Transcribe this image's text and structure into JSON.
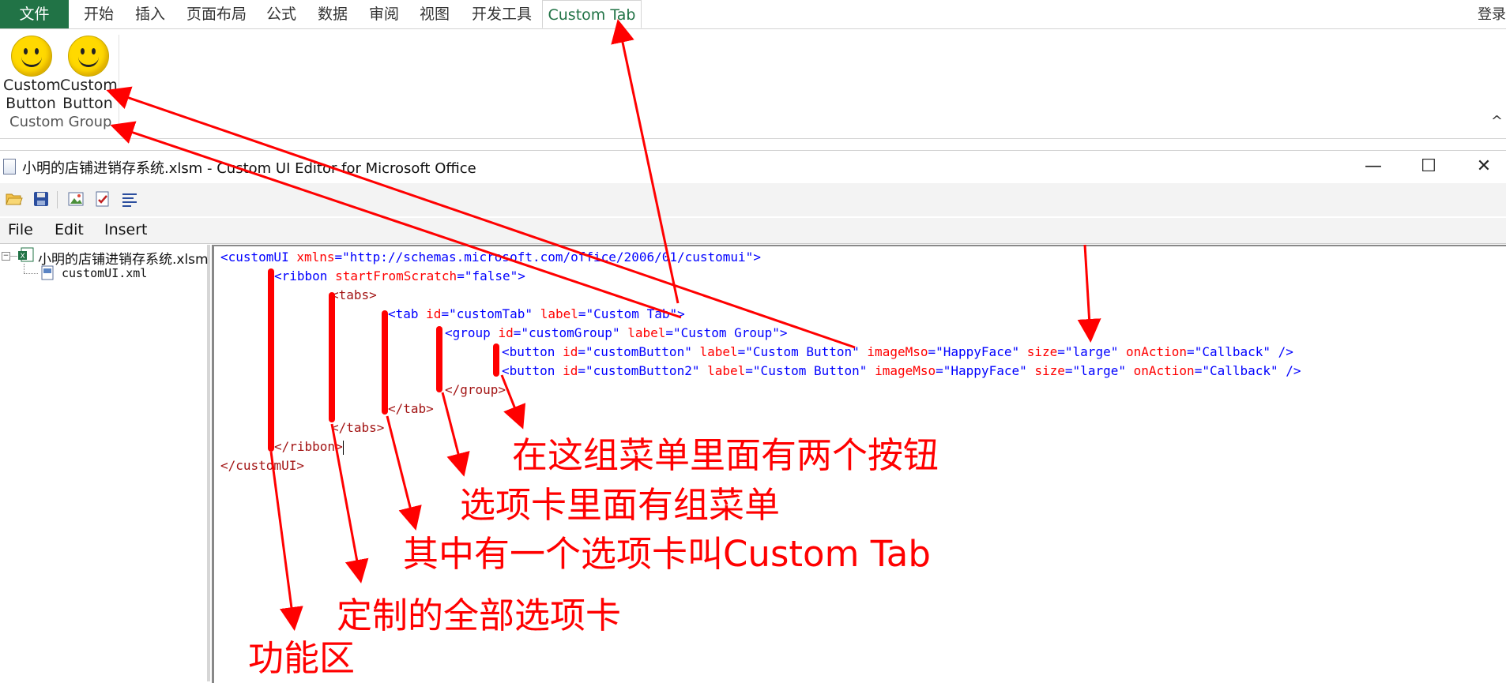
{
  "ribbon": {
    "tabs": [
      "文件",
      "开始",
      "插入",
      "页面布局",
      "公式",
      "数据",
      "审阅",
      "视图",
      "开发工具",
      "Custom Tab"
    ],
    "signin": "登录",
    "buttons": [
      {
        "label_line1": "Custom",
        "label_line2": "Button",
        "icon": "happy-face-icon"
      },
      {
        "label_line1": "Custom",
        "label_line2": "Button",
        "icon": "happy-face-icon"
      }
    ],
    "group_label": "Custom Group",
    "collapse_icon": "^"
  },
  "window": {
    "title": "小明的店铺进销存系统.xlsm - Custom UI Editor for Microsoft Office",
    "controls": {
      "minimize": "—",
      "maximize": "☐",
      "close": "✕"
    }
  },
  "menu": {
    "file": "File",
    "edit": "Edit",
    "insert": "Insert"
  },
  "tree": {
    "root": "小明的店铺进销存系统.xlsm",
    "child": "customUI.xml"
  },
  "code": {
    "line1": {
      "open": "<customUI ",
      "attr": "xmlns",
      "eq": "=",
      "val": "\"http://schemas.microsoft.com/office/2006/01/customui\"",
      "close": ">"
    },
    "line2": {
      "open": "<ribbon ",
      "attr": "startFromScratch",
      "eq": "=",
      "val": "\"false\"",
      "close": ">"
    },
    "line3": "<tabs>",
    "line4": {
      "open": "<tab ",
      "a1": "id",
      "v1": "\"customTab\"",
      "a2": "label",
      "v2": "\"Custom Tab\"",
      "close": ">"
    },
    "line5": {
      "open": "<group ",
      "a1": "id",
      "v1": "\"customGroup\"",
      "a2": "label",
      "v2": "\"Custom Group\"",
      "close": ">"
    },
    "line6": {
      "open": "<button ",
      "a1": "id",
      "v1": "\"customButton\"",
      "a2": "label",
      "v2": "\"Custom Button\"",
      "a3": "imageMso",
      "v3": "\"HappyFace\"",
      "a4": "size",
      "v4": "\"large\"",
      "a5": "onAction",
      "v5": "\"Callback\"",
      "close": " />"
    },
    "line7": {
      "open": "<button ",
      "a1": "id",
      "v1": "\"customButton2\"",
      "a2": "label",
      "v2": "\"Custom Button\"",
      "a3": "imageMso",
      "v3": "\"HappyFace\"",
      "a4": "size",
      "v4": "\"large\"",
      "a5": "onAction",
      "v5": "\"Callback\"",
      "close": " />"
    },
    "line8": "</group>",
    "line9": "</tab>",
    "line10": "</tabs>",
    "line11": "</ribbon>",
    "line12": "</customUI>"
  },
  "annotations": {
    "two_buttons": "在这组菜单里面有两个按钮",
    "group_in_tab": "选项卡里面有组菜单",
    "custom_tab": "其中有一个选项卡叫Custom Tab",
    "all_tabs": "定制的全部选项卡",
    "ribbon": "功能区"
  },
  "colors": {
    "excel_green": "#217346",
    "annotation_red": "#ff0000",
    "xml_tag": "#a31515",
    "xml_attr": "#ff0000",
    "xml_value": "#0000ff"
  }
}
